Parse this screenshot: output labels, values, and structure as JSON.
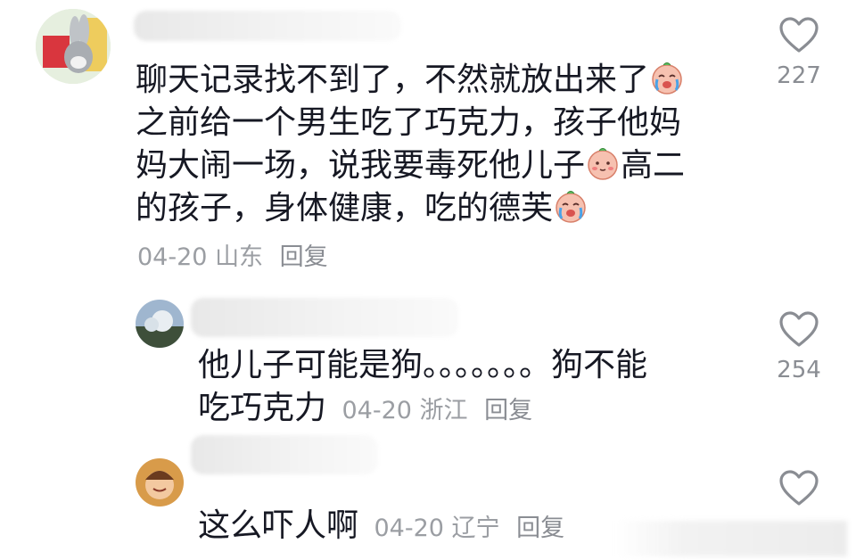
{
  "comments": [
    {
      "text_lines": [
        "聊天记录找不到了，不然就放出来了",
        "之前给一个男生吃了巧克力，孩子他妈",
        "妈大闹一场，说我要毒死他儿子",
        "高二",
        "的孩子，身体健康，吃的德芙"
      ],
      "date": "04-20",
      "location": "山东",
      "reply_label": "回复",
      "likes": "227"
    },
    {
      "text_line1": "他儿子可能是狗。。。。。。。狗不能",
      "text_line2": "吃巧克力",
      "date": "04-20",
      "location": "浙江",
      "reply_label": "回复",
      "likes": "254"
    },
    {
      "text": "这么吓人啊",
      "date": "04-20",
      "location": "辽宁",
      "reply_label": "回复"
    }
  ],
  "icons": {
    "like": "heart-outline-icon",
    "emoji_cry": "crying-face-emoji",
    "emoji_blush": "blushing-face-emoji"
  },
  "colors": {
    "text": "#161823",
    "meta": "#9b9ea3",
    "icon": "#8a8d93"
  }
}
